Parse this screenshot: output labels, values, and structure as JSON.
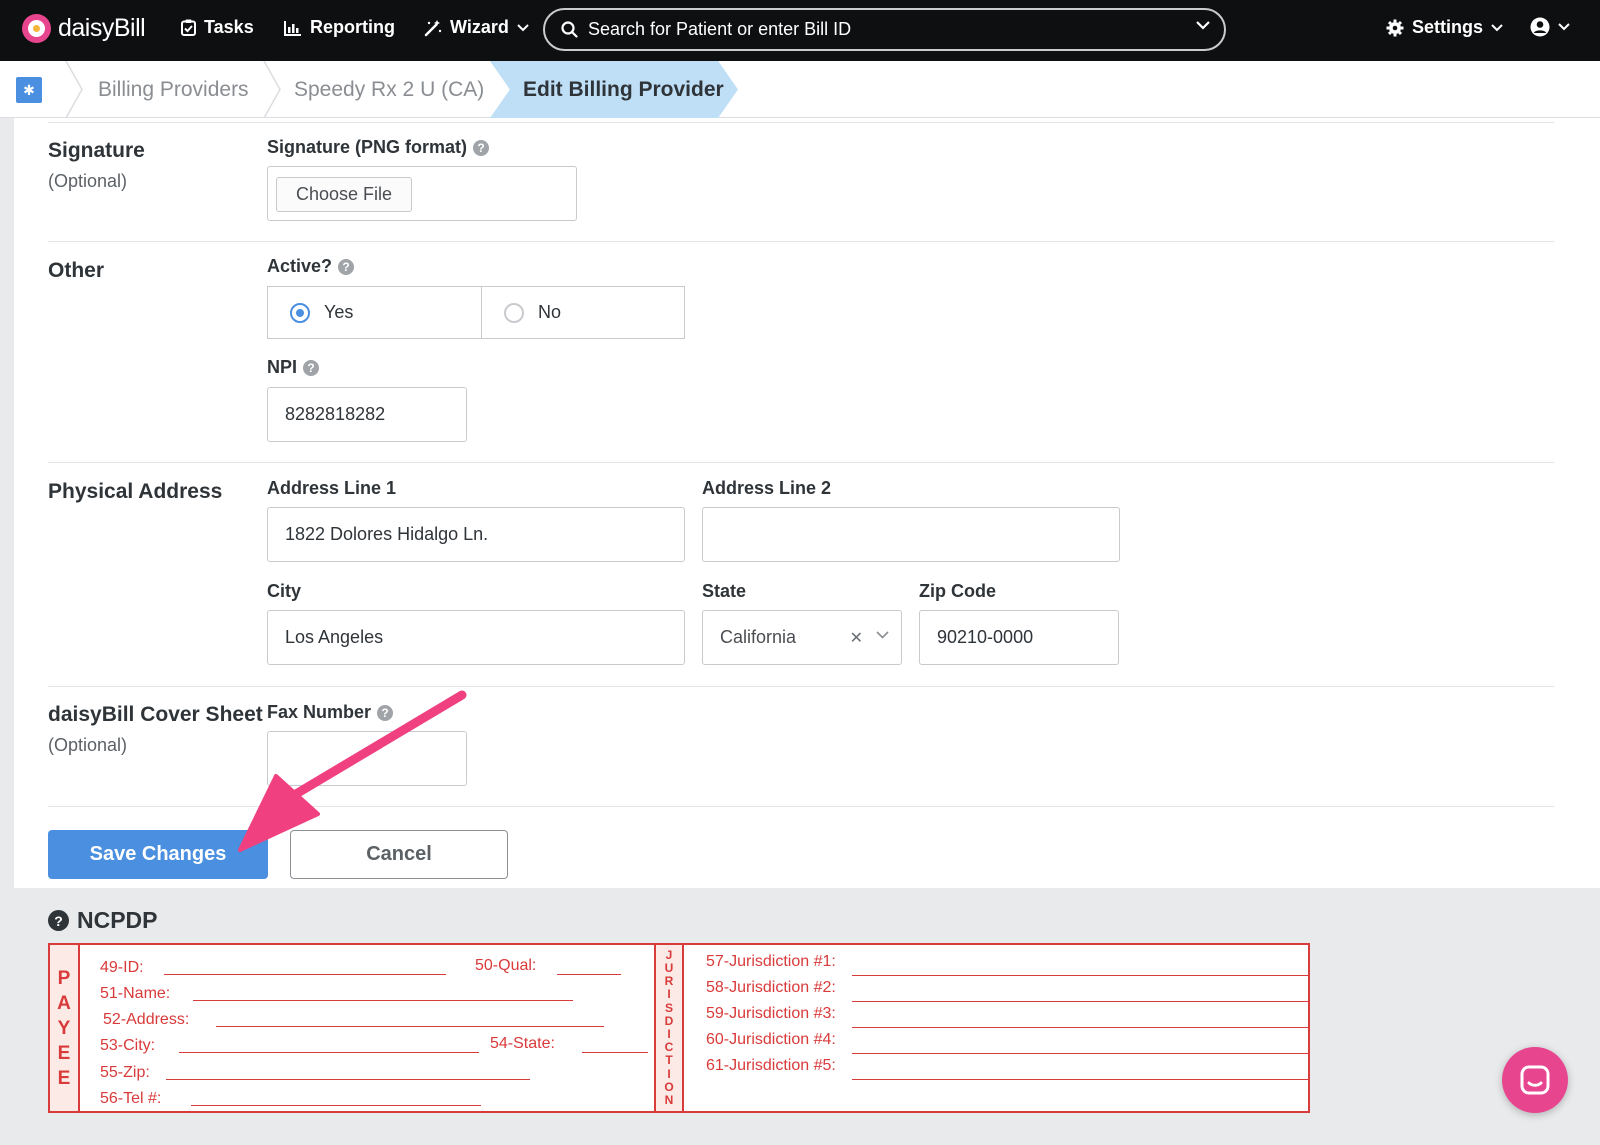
{
  "nav": {
    "brand": "daisyBill",
    "tasks": "Tasks",
    "reporting": "Reporting",
    "wizard": "Wizard",
    "search_placeholder": "Search for Patient or enter Bill ID",
    "settings": "Settings"
  },
  "breadcrumb": {
    "items": [
      "Billing Providers",
      "Speedy Rx 2 U (CA)",
      "Edit Billing Provider"
    ]
  },
  "signature": {
    "title": "Signature",
    "subtitle": "(Optional)",
    "field_label": "Signature (PNG format)",
    "file_button": "Choose File"
  },
  "other": {
    "title": "Other",
    "active_label": "Active?",
    "yes_label": "Yes",
    "no_label": "No",
    "active_value": "Yes",
    "npi_label": "NPI",
    "npi_value": "8282818282"
  },
  "address": {
    "title": "Physical Address",
    "line1_label": "Address Line 1",
    "line1_value": "1822 Dolores Hidalgo Ln.",
    "line2_label": "Address Line 2",
    "line2_value": "",
    "city_label": "City",
    "city_value": "Los Angeles",
    "state_label": "State",
    "state_value": "California",
    "zip_label": "Zip Code",
    "zip_value": "90210-0000"
  },
  "cover_sheet": {
    "title": "daisyBill Cover Sheet",
    "subtitle": "(Optional)",
    "fax_label": "Fax Number",
    "fax_value": ""
  },
  "actions": {
    "save": "Save Changes",
    "cancel": "Cancel"
  },
  "ncpdp": {
    "title": "NCPDP",
    "payee_letters": [
      "P",
      "A",
      "Y",
      "E",
      "E"
    ],
    "jurisdiction_letters": [
      "J",
      "U",
      "R",
      "I",
      "S",
      "D",
      "I",
      "C",
      "T",
      "I",
      "O",
      "N"
    ],
    "fields": {
      "id": "49-ID:",
      "qual": "50-Qual:",
      "name": "51-Name:",
      "address": "52-Address:",
      "city": "53-City:",
      "state": "54-State:",
      "zip": "55-Zip:",
      "tel": "56-Tel #:"
    },
    "jurisdictions": [
      "57-Jurisdiction #1:",
      "58-Jurisdiction #2:",
      "59-Jurisdiction #3:",
      "60-Jurisdiction #4:",
      "61-Jurisdiction #5:"
    ]
  },
  "colors": {
    "accent": "#4a8fe0",
    "brand_pink": "#e8458f",
    "form_red": "#d93a3a",
    "breadcrumb_active": "#bfdff7"
  }
}
